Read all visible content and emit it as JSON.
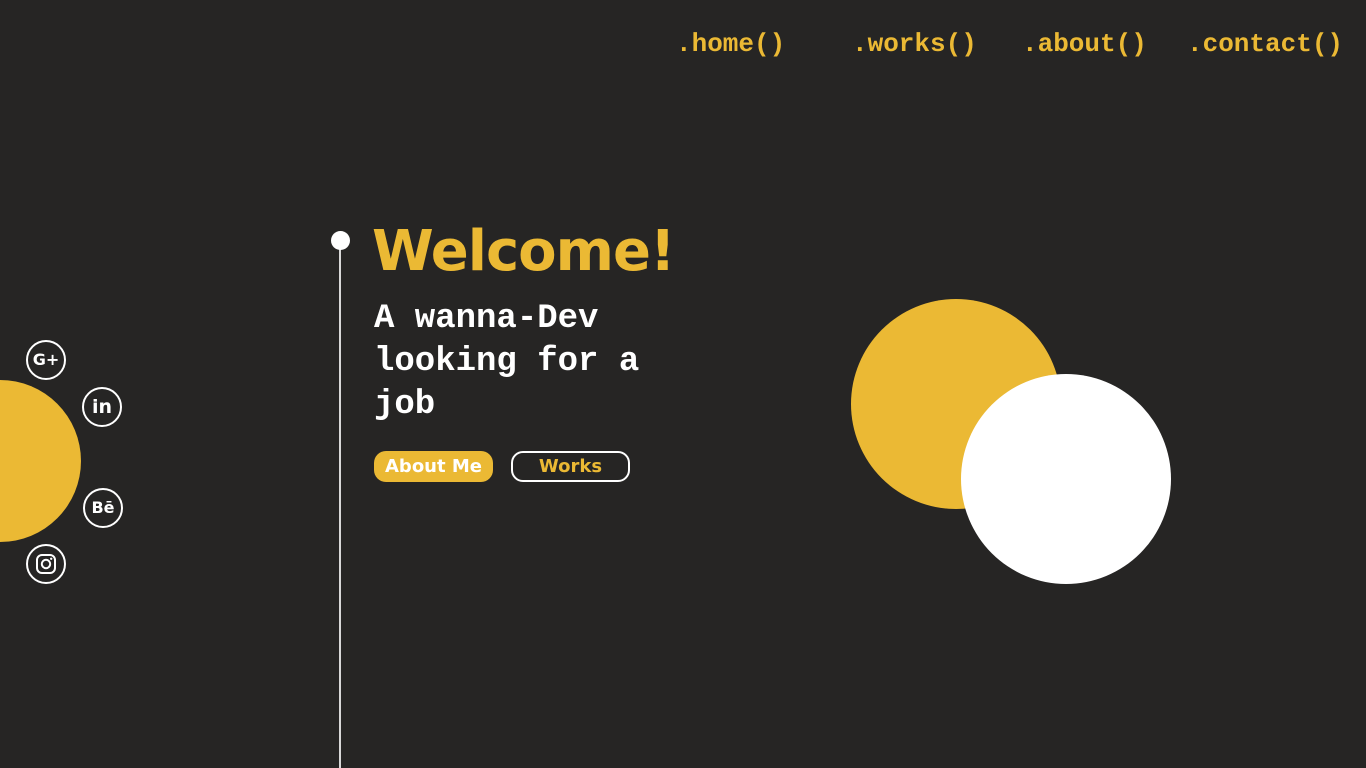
{
  "colors": {
    "background": "#262524",
    "accent": "#ebb934",
    "white": "#ffffff"
  },
  "nav": {
    "items": [
      {
        "label": ".home()"
      },
      {
        "label": ".works()"
      },
      {
        "label": ".about()"
      },
      {
        "label": ".contact()"
      }
    ]
  },
  "social": {
    "gplus": {
      "icon": "google-plus-icon",
      "glyph": "G+"
    },
    "linkedin": {
      "icon": "linkedin-icon",
      "glyph": "in"
    },
    "behance": {
      "icon": "behance-icon",
      "glyph": "Bē"
    },
    "instagram": {
      "icon": "instagram-icon"
    }
  },
  "hero": {
    "title": "Welcome!",
    "tagline": "A wanna-Dev looking for a job"
  },
  "buttons": {
    "about_label": "About Me",
    "works_label": "Works"
  }
}
